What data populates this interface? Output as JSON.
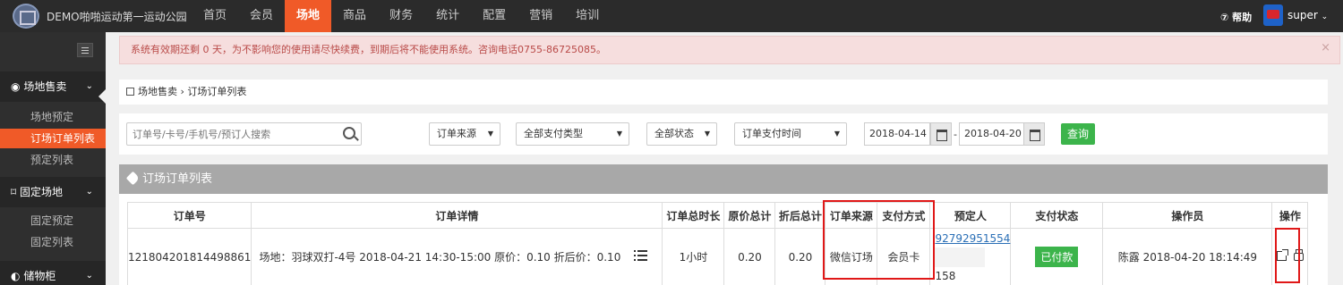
{
  "app": {
    "brand": "DEMO啪啪运动第一运动公园",
    "help": "帮助",
    "user": "super"
  },
  "nav": [
    "首页",
    "会员",
    "场地",
    "商品",
    "财务",
    "统计",
    "配置",
    "营销",
    "培训"
  ],
  "nav_active": "场地",
  "sidebar": {
    "groups": [
      {
        "label": "场地售卖",
        "items": [
          "场地预定",
          "订场订单列表",
          "预定列表"
        ]
      },
      {
        "label": "固定场地",
        "items": [
          "固定预定",
          "固定列表"
        ]
      },
      {
        "label": "储物柜",
        "items": []
      }
    ],
    "active_item": "订场订单列表"
  },
  "alert": {
    "text": "系统有效期还剩 0 天，为不影响您的使用请尽快续费，到期后将不能使用系统。咨询电话0755-86725085。",
    "close": "×"
  },
  "breadcrumb": {
    "parent": "场地售卖",
    "separator": "›",
    "current": "订场订单列表"
  },
  "filters": {
    "search_placeholder": "订单号/卡号/手机号/预订人搜索",
    "source": "订单来源",
    "pay_type": "全部支付类型",
    "status": "全部状态",
    "pay_time": "订单支付时间",
    "date_from": "2018-04-14",
    "date_sep": "-",
    "date_to": "2018-04-20",
    "query": "查询"
  },
  "panel": {
    "title": "订场订单列表"
  },
  "table": {
    "headers": [
      "订单号",
      "订单详情",
      "订单总时长",
      "原价总计",
      "折后总计",
      "订单来源",
      "支付方式",
      "预定人",
      "支付状态",
      "操作员",
      "操作"
    ],
    "rows": [
      {
        "order_no": "121804201814498861",
        "detail": "场地：羽球双打-4号 2018-04-21 14:30-15:00   原价：0.10   折后价：0.10",
        "duration": "1小时",
        "orig_total": "0.20",
        "disc_total": "0.20",
        "source": "微信订场",
        "pay_method": "会员卡",
        "booker_phone": "92792951554",
        "booker_phone2": "158",
        "pay_status": "已付款",
        "operator": "陈露 2018-04-20 18:14:49"
      }
    ]
  },
  "colors": {
    "accent": "#f05a28",
    "success": "#3cb44b",
    "highlight_box": "#e01818"
  }
}
